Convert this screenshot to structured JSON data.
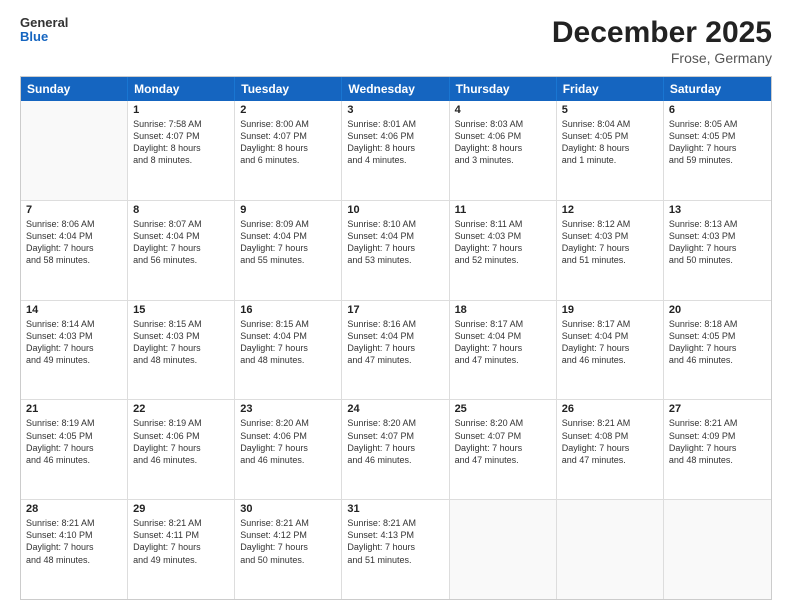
{
  "header": {
    "logo_general": "General",
    "logo_blue": "Blue",
    "month_title": "December 2025",
    "location": "Frose, Germany"
  },
  "weekdays": [
    "Sunday",
    "Monday",
    "Tuesday",
    "Wednesday",
    "Thursday",
    "Friday",
    "Saturday"
  ],
  "rows": [
    [
      {
        "day": "",
        "sunrise": "",
        "sunset": "",
        "daylight": ""
      },
      {
        "day": "1",
        "sunrise": "Sunrise: 7:58 AM",
        "sunset": "Sunset: 4:07 PM",
        "daylight": "Daylight: 8 hours and 8 minutes."
      },
      {
        "day": "2",
        "sunrise": "Sunrise: 8:00 AM",
        "sunset": "Sunset: 4:07 PM",
        "daylight": "Daylight: 8 hours and 6 minutes."
      },
      {
        "day": "3",
        "sunrise": "Sunrise: 8:01 AM",
        "sunset": "Sunset: 4:06 PM",
        "daylight": "Daylight: 8 hours and 4 minutes."
      },
      {
        "day": "4",
        "sunrise": "Sunrise: 8:03 AM",
        "sunset": "Sunset: 4:06 PM",
        "daylight": "Daylight: 8 hours and 3 minutes."
      },
      {
        "day": "5",
        "sunrise": "Sunrise: 8:04 AM",
        "sunset": "Sunset: 4:05 PM",
        "daylight": "Daylight: 8 hours and 1 minute."
      },
      {
        "day": "6",
        "sunrise": "Sunrise: 8:05 AM",
        "sunset": "Sunset: 4:05 PM",
        "daylight": "Daylight: 7 hours and 59 minutes."
      }
    ],
    [
      {
        "day": "7",
        "sunrise": "Sunrise: 8:06 AM",
        "sunset": "Sunset: 4:04 PM",
        "daylight": "Daylight: 7 hours and 58 minutes."
      },
      {
        "day": "8",
        "sunrise": "Sunrise: 8:07 AM",
        "sunset": "Sunset: 4:04 PM",
        "daylight": "Daylight: 7 hours and 56 minutes."
      },
      {
        "day": "9",
        "sunrise": "Sunrise: 8:09 AM",
        "sunset": "Sunset: 4:04 PM",
        "daylight": "Daylight: 7 hours and 55 minutes."
      },
      {
        "day": "10",
        "sunrise": "Sunrise: 8:10 AM",
        "sunset": "Sunset: 4:04 PM",
        "daylight": "Daylight: 7 hours and 53 minutes."
      },
      {
        "day": "11",
        "sunrise": "Sunrise: 8:11 AM",
        "sunset": "Sunset: 4:03 PM",
        "daylight": "Daylight: 7 hours and 52 minutes."
      },
      {
        "day": "12",
        "sunrise": "Sunrise: 8:12 AM",
        "sunset": "Sunset: 4:03 PM",
        "daylight": "Daylight: 7 hours and 51 minutes."
      },
      {
        "day": "13",
        "sunrise": "Sunrise: 8:13 AM",
        "sunset": "Sunset: 4:03 PM",
        "daylight": "Daylight: 7 hours and 50 minutes."
      }
    ],
    [
      {
        "day": "14",
        "sunrise": "Sunrise: 8:14 AM",
        "sunset": "Sunset: 4:03 PM",
        "daylight": "Daylight: 7 hours and 49 minutes."
      },
      {
        "day": "15",
        "sunrise": "Sunrise: 8:15 AM",
        "sunset": "Sunset: 4:03 PM",
        "daylight": "Daylight: 7 hours and 48 minutes."
      },
      {
        "day": "16",
        "sunrise": "Sunrise: 8:15 AM",
        "sunset": "Sunset: 4:04 PM",
        "daylight": "Daylight: 7 hours and 48 minutes."
      },
      {
        "day": "17",
        "sunrise": "Sunrise: 8:16 AM",
        "sunset": "Sunset: 4:04 PM",
        "daylight": "Daylight: 7 hours and 47 minutes."
      },
      {
        "day": "18",
        "sunrise": "Sunrise: 8:17 AM",
        "sunset": "Sunset: 4:04 PM",
        "daylight": "Daylight: 7 hours and 47 minutes."
      },
      {
        "day": "19",
        "sunrise": "Sunrise: 8:17 AM",
        "sunset": "Sunset: 4:04 PM",
        "daylight": "Daylight: 7 hours and 46 minutes."
      },
      {
        "day": "20",
        "sunrise": "Sunrise: 8:18 AM",
        "sunset": "Sunset: 4:05 PM",
        "daylight": "Daylight: 7 hours and 46 minutes."
      }
    ],
    [
      {
        "day": "21",
        "sunrise": "Sunrise: 8:19 AM",
        "sunset": "Sunset: 4:05 PM",
        "daylight": "Daylight: 7 hours and 46 minutes."
      },
      {
        "day": "22",
        "sunrise": "Sunrise: 8:19 AM",
        "sunset": "Sunset: 4:06 PM",
        "daylight": "Daylight: 7 hours and 46 minutes."
      },
      {
        "day": "23",
        "sunrise": "Sunrise: 8:20 AM",
        "sunset": "Sunset: 4:06 PM",
        "daylight": "Daylight: 7 hours and 46 minutes."
      },
      {
        "day": "24",
        "sunrise": "Sunrise: 8:20 AM",
        "sunset": "Sunset: 4:07 PM",
        "daylight": "Daylight: 7 hours and 46 minutes."
      },
      {
        "day": "25",
        "sunrise": "Sunrise: 8:20 AM",
        "sunset": "Sunset: 4:07 PM",
        "daylight": "Daylight: 7 hours and 47 minutes."
      },
      {
        "day": "26",
        "sunrise": "Sunrise: 8:21 AM",
        "sunset": "Sunset: 4:08 PM",
        "daylight": "Daylight: 7 hours and 47 minutes."
      },
      {
        "day": "27",
        "sunrise": "Sunrise: 8:21 AM",
        "sunset": "Sunset: 4:09 PM",
        "daylight": "Daylight: 7 hours and 48 minutes."
      }
    ],
    [
      {
        "day": "28",
        "sunrise": "Sunrise: 8:21 AM",
        "sunset": "Sunset: 4:10 PM",
        "daylight": "Daylight: 7 hours and 48 minutes."
      },
      {
        "day": "29",
        "sunrise": "Sunrise: 8:21 AM",
        "sunset": "Sunset: 4:11 PM",
        "daylight": "Daylight: 7 hours and 49 minutes."
      },
      {
        "day": "30",
        "sunrise": "Sunrise: 8:21 AM",
        "sunset": "Sunset: 4:12 PM",
        "daylight": "Daylight: 7 hours and 50 minutes."
      },
      {
        "day": "31",
        "sunrise": "Sunrise: 8:21 AM",
        "sunset": "Sunset: 4:13 PM",
        "daylight": "Daylight: 7 hours and 51 minutes."
      },
      {
        "day": "",
        "sunrise": "",
        "sunset": "",
        "daylight": ""
      },
      {
        "day": "",
        "sunrise": "",
        "sunset": "",
        "daylight": ""
      },
      {
        "day": "",
        "sunrise": "",
        "sunset": "",
        "daylight": ""
      }
    ]
  ]
}
